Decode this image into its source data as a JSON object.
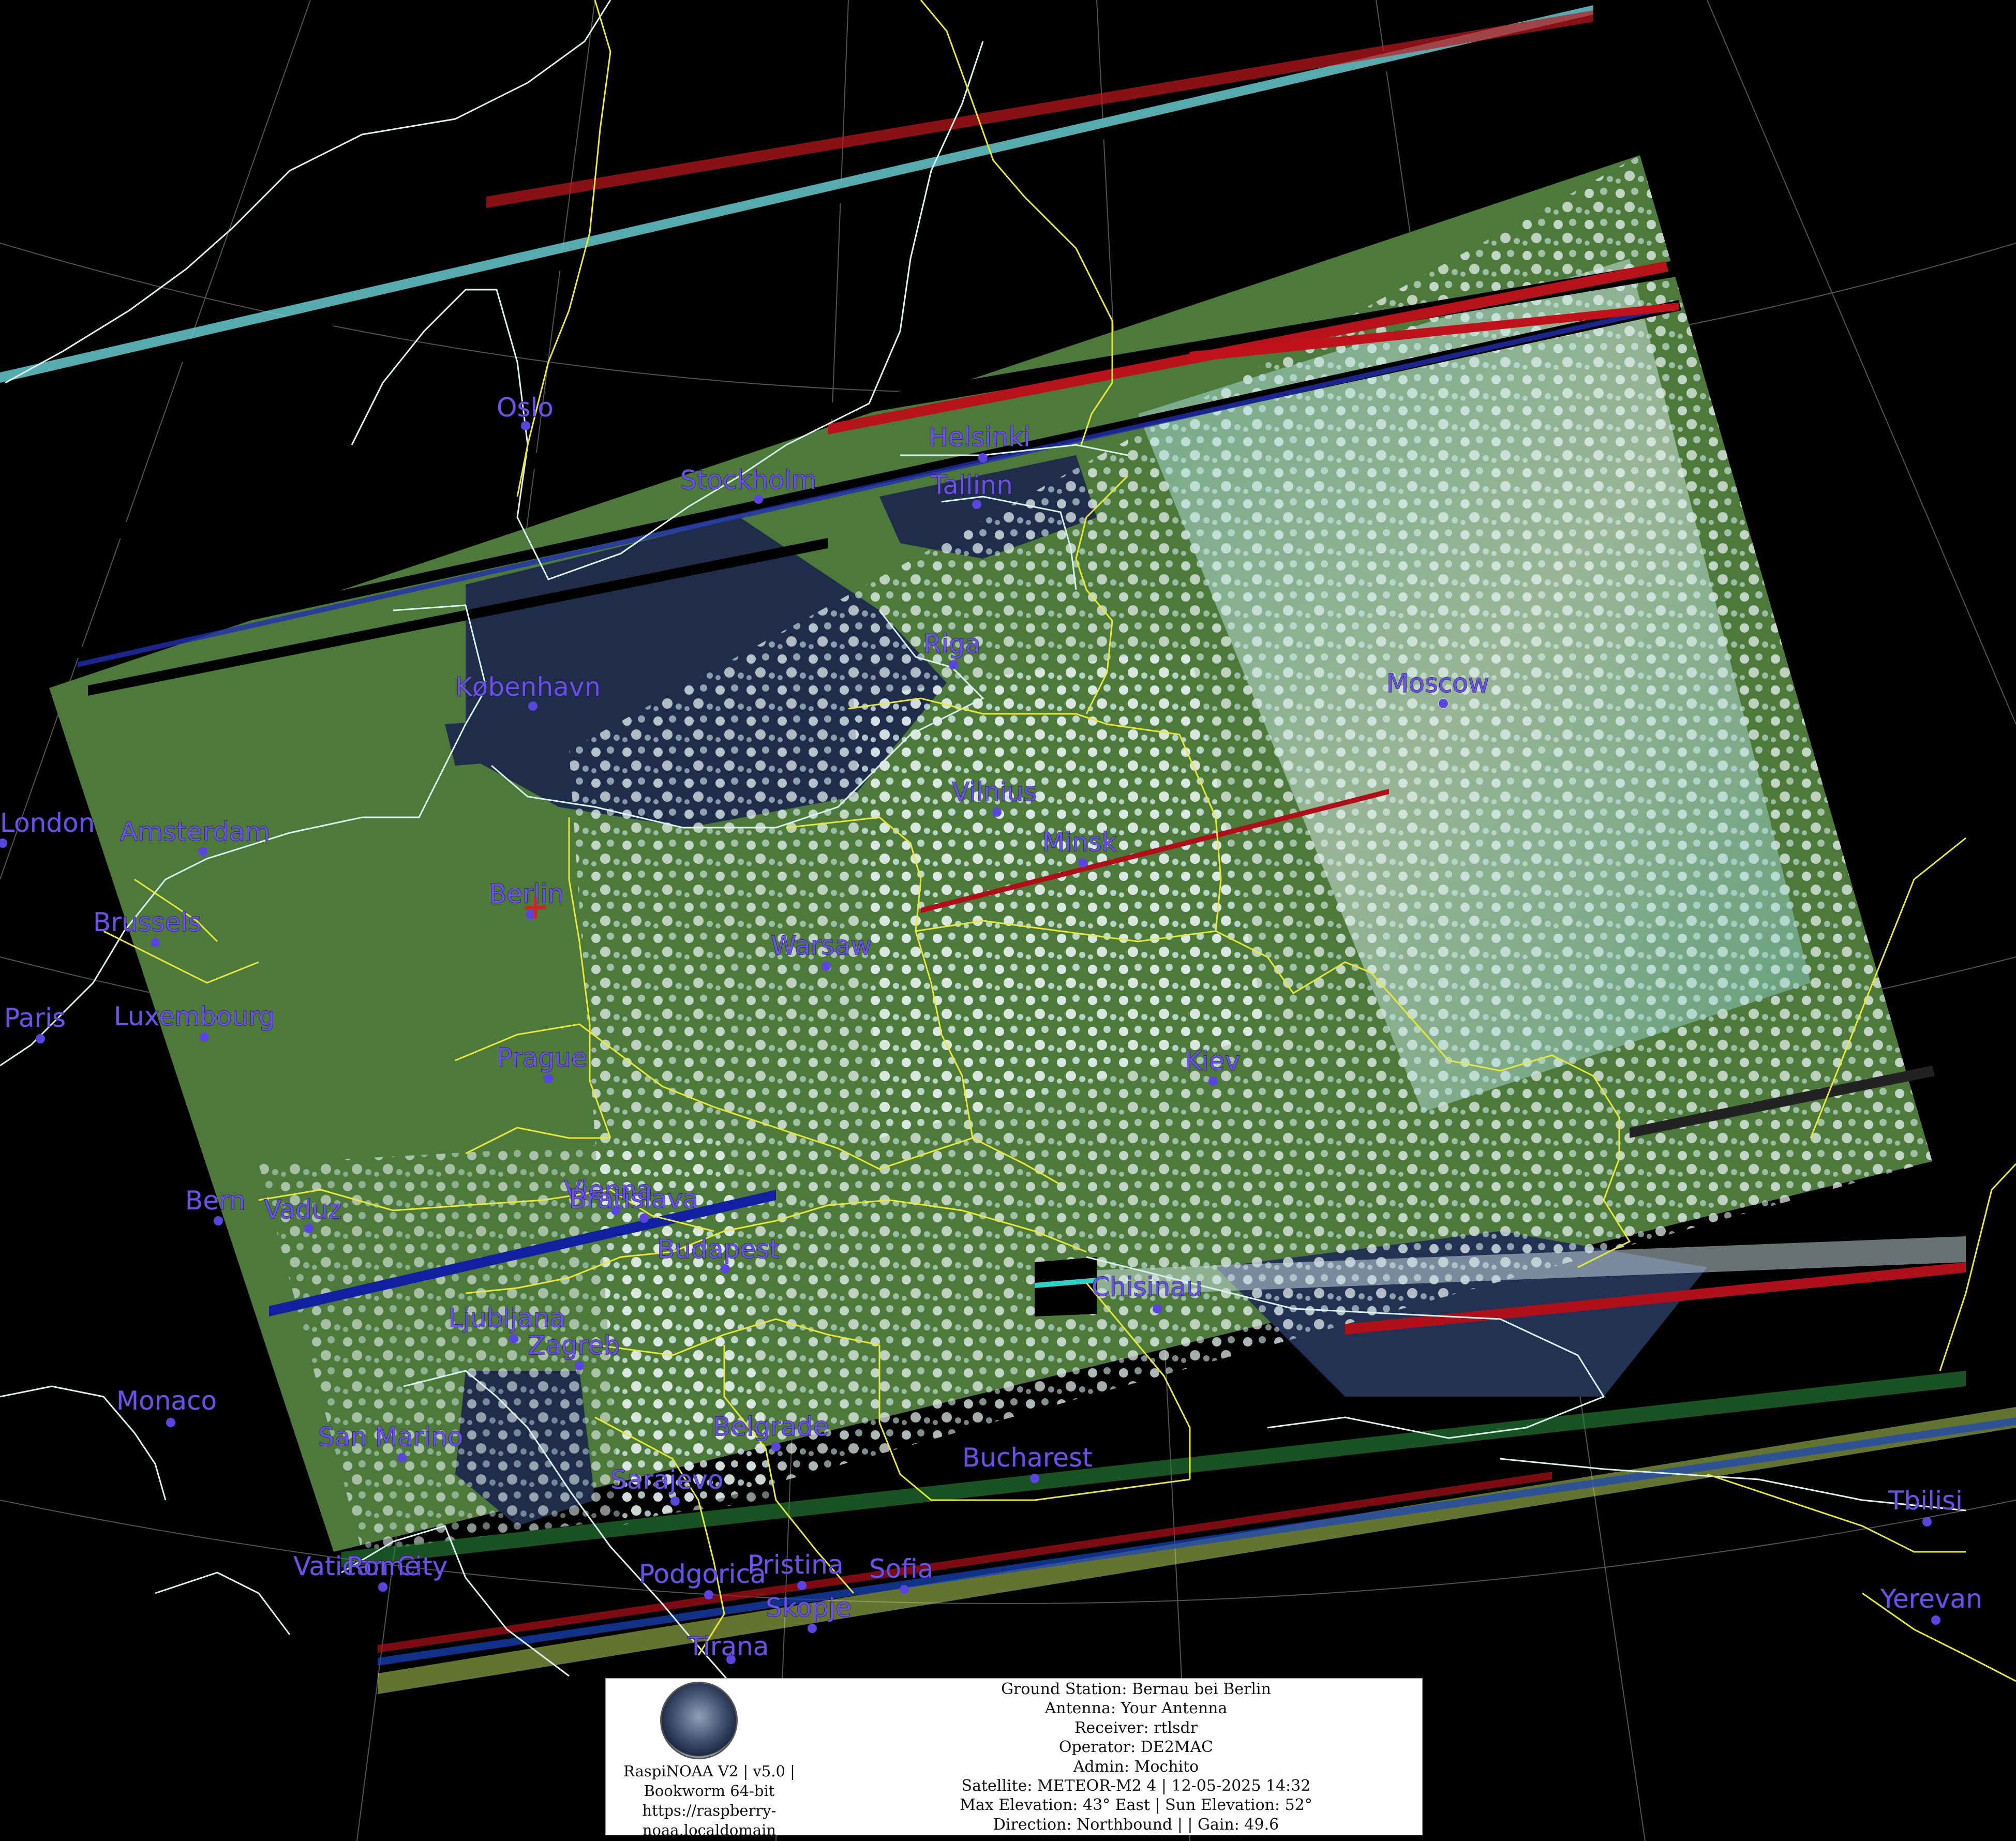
{
  "map": {
    "colors": {
      "background": "#000000",
      "coastline": "#d9f2ee",
      "border": "#e8e838",
      "graticule": "#8a8a8a",
      "city_label": "#6a52e6",
      "land": "#4e7a3c",
      "water": "#1d2c4a",
      "cloud": "#dfeff2",
      "cloud_cyan": "#8ee4ea"
    },
    "cities": [
      {
        "name": "Oslo"
      },
      {
        "name": "Stockholm"
      },
      {
        "name": "Helsinki"
      },
      {
        "name": "Tallinn"
      },
      {
        "name": "Riga"
      },
      {
        "name": "København"
      },
      {
        "name": "Moscow"
      },
      {
        "name": "Vilnius"
      },
      {
        "name": "Minsk"
      },
      {
        "name": "London"
      },
      {
        "name": "Amsterdam"
      },
      {
        "name": "Berlin"
      },
      {
        "name": "Brussels"
      },
      {
        "name": "Warsaw"
      },
      {
        "name": "Paris"
      },
      {
        "name": "Luxembourg"
      },
      {
        "name": "Prague"
      },
      {
        "name": "Kiev"
      },
      {
        "name": "Bern"
      },
      {
        "name": "Vaduz"
      },
      {
        "name": "Vienna"
      },
      {
        "name": "Bratislava"
      },
      {
        "name": "Budapest"
      },
      {
        "name": "Chisinau"
      },
      {
        "name": "Ljubljana"
      },
      {
        "name": "Zagreb"
      },
      {
        "name": "Monaco"
      },
      {
        "name": "San Marino"
      },
      {
        "name": "Belgrade"
      },
      {
        "name": "Bucharest"
      },
      {
        "name": "Sarajevo"
      },
      {
        "name": "Tbilisi"
      },
      {
        "name": "Vatican City"
      },
      {
        "name": "Rome"
      },
      {
        "name": "Podgorica"
      },
      {
        "name": "Pristina"
      },
      {
        "name": "Sofia"
      },
      {
        "name": "Skopje"
      },
      {
        "name": "Yerevan"
      },
      {
        "name": "Tirana"
      }
    ],
    "ground_station_marker": "red-cross"
  },
  "info_box": {
    "software": [
      "RaspiNOAA V2 | v5.0 |",
      "Bookworm 64-bit",
      "https://raspberry-",
      "noaa.localdomain"
    ],
    "lines": [
      "Ground Station: Bernau bei Berlin",
      "Antenna: Your Antenna",
      "Receiver: rtlsdr",
      "Operator: DE2MAC",
      "Admin: Mochito",
      "Satellite: METEOR-M2 4 | 12-05-2025 14:32",
      "Max Elevation: 43° East | Sun Elevation: 52°",
      "Direction: Northbound | | Gain: 49.6"
    ]
  }
}
